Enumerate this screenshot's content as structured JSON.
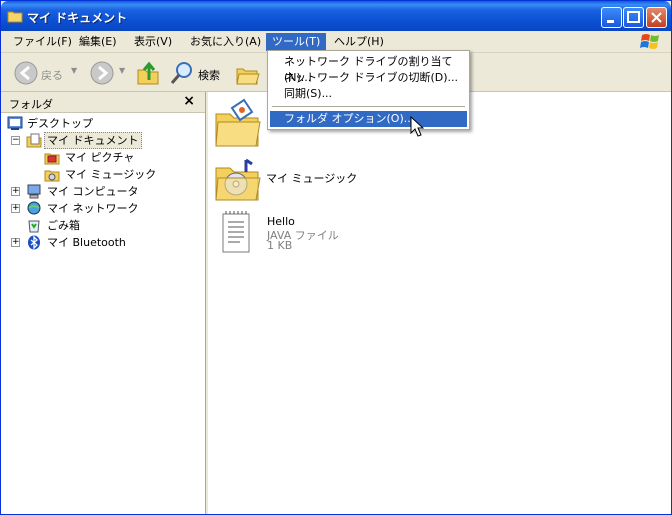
{
  "window": {
    "title": "マイ ドキュメント"
  },
  "menubar": {
    "items": [
      {
        "label": "ファイル(F)"
      },
      {
        "label": "編集(E)"
      },
      {
        "label": "表示(V)"
      },
      {
        "label": "お気に入り(A)"
      },
      {
        "label": "ツール(T)"
      },
      {
        "label": "ヘルプ(H)"
      }
    ]
  },
  "toolbar": {
    "back_label": "戻る",
    "search_label": "検索"
  },
  "tools_menu": {
    "items": [
      {
        "label": "ネットワーク ドライブの割り当て(N)..."
      },
      {
        "label": "ネットワーク ドライブの切断(D)..."
      },
      {
        "label": "同期(S)..."
      },
      {
        "label": "フォルダ オプション(O)..."
      }
    ]
  },
  "folder_pane": {
    "title": "フォルダ",
    "close": "×",
    "tree": [
      {
        "label": "デスクトップ"
      },
      {
        "label": "マイ ドキュメント"
      },
      {
        "label": "マイ ピクチャ"
      },
      {
        "label": "マイ ミュージック"
      },
      {
        "label": "マイ コンピュータ"
      },
      {
        "label": "マイ ネットワーク"
      },
      {
        "label": "ごみ箱"
      },
      {
        "label": "マイ Bluetooth"
      }
    ]
  },
  "content": {
    "items": [
      {
        "name": "マイ ミュージック"
      },
      {
        "name": "Hello",
        "type": "JAVA ファイル",
        "size": "1 KB"
      }
    ]
  },
  "colors": {
    "title_blue": "#0a4fd1",
    "menu_highlight": "#316ac5",
    "chrome": "#ece9d8"
  }
}
